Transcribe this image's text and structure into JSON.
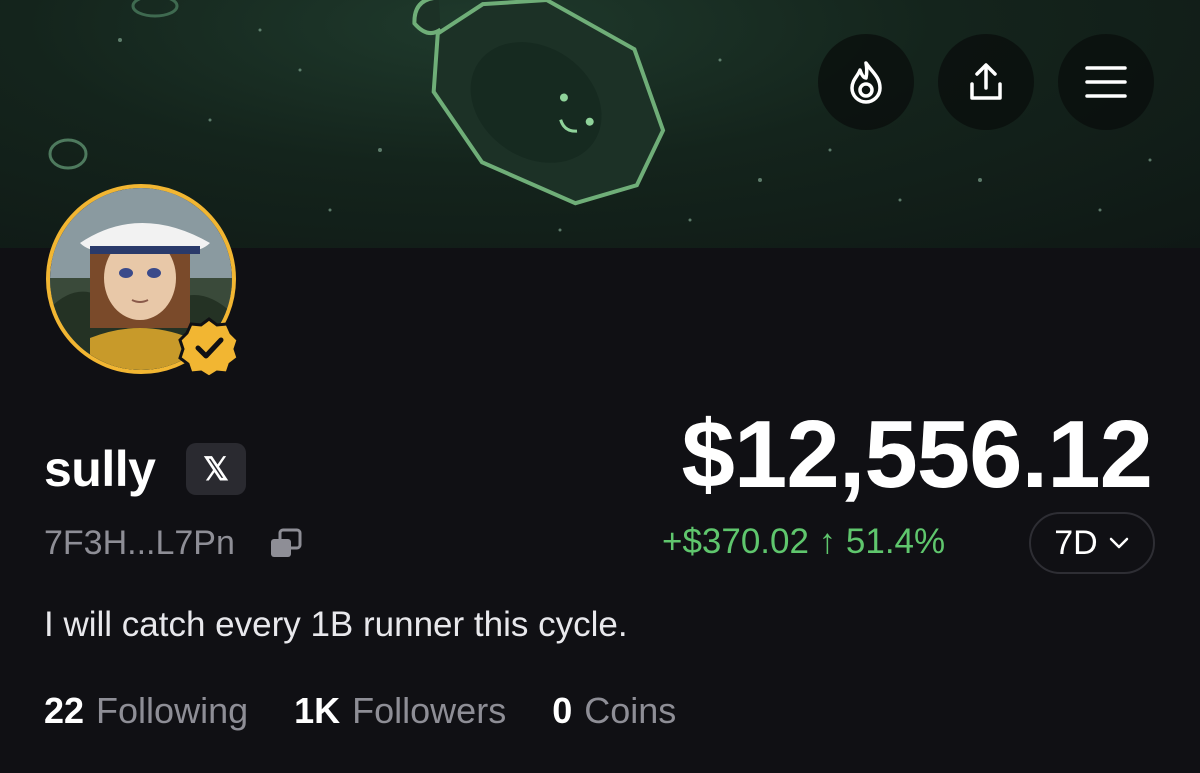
{
  "profile": {
    "name": "sully",
    "social_badge": "𝕏",
    "address": "7F3H...L7Pn",
    "bio": "I will catch every 1B runner this cycle.",
    "verified": true
  },
  "portfolio": {
    "balance": "$12,556.12",
    "change": "+$370.02 ↑ 51.4%",
    "period": "7D",
    "change_color": "#5fc66d"
  },
  "stats": [
    {
      "count": "22",
      "label": "Following"
    },
    {
      "count": "1K",
      "label": "Followers"
    },
    {
      "count": "0",
      "label": "Coins"
    }
  ],
  "header_actions": {
    "icons": [
      "flame-icon",
      "share-icon",
      "menu-icon"
    ]
  },
  "colors": {
    "background": "#101014",
    "avatar_ring": "#f2b632",
    "banner": "#1f3a2c"
  }
}
